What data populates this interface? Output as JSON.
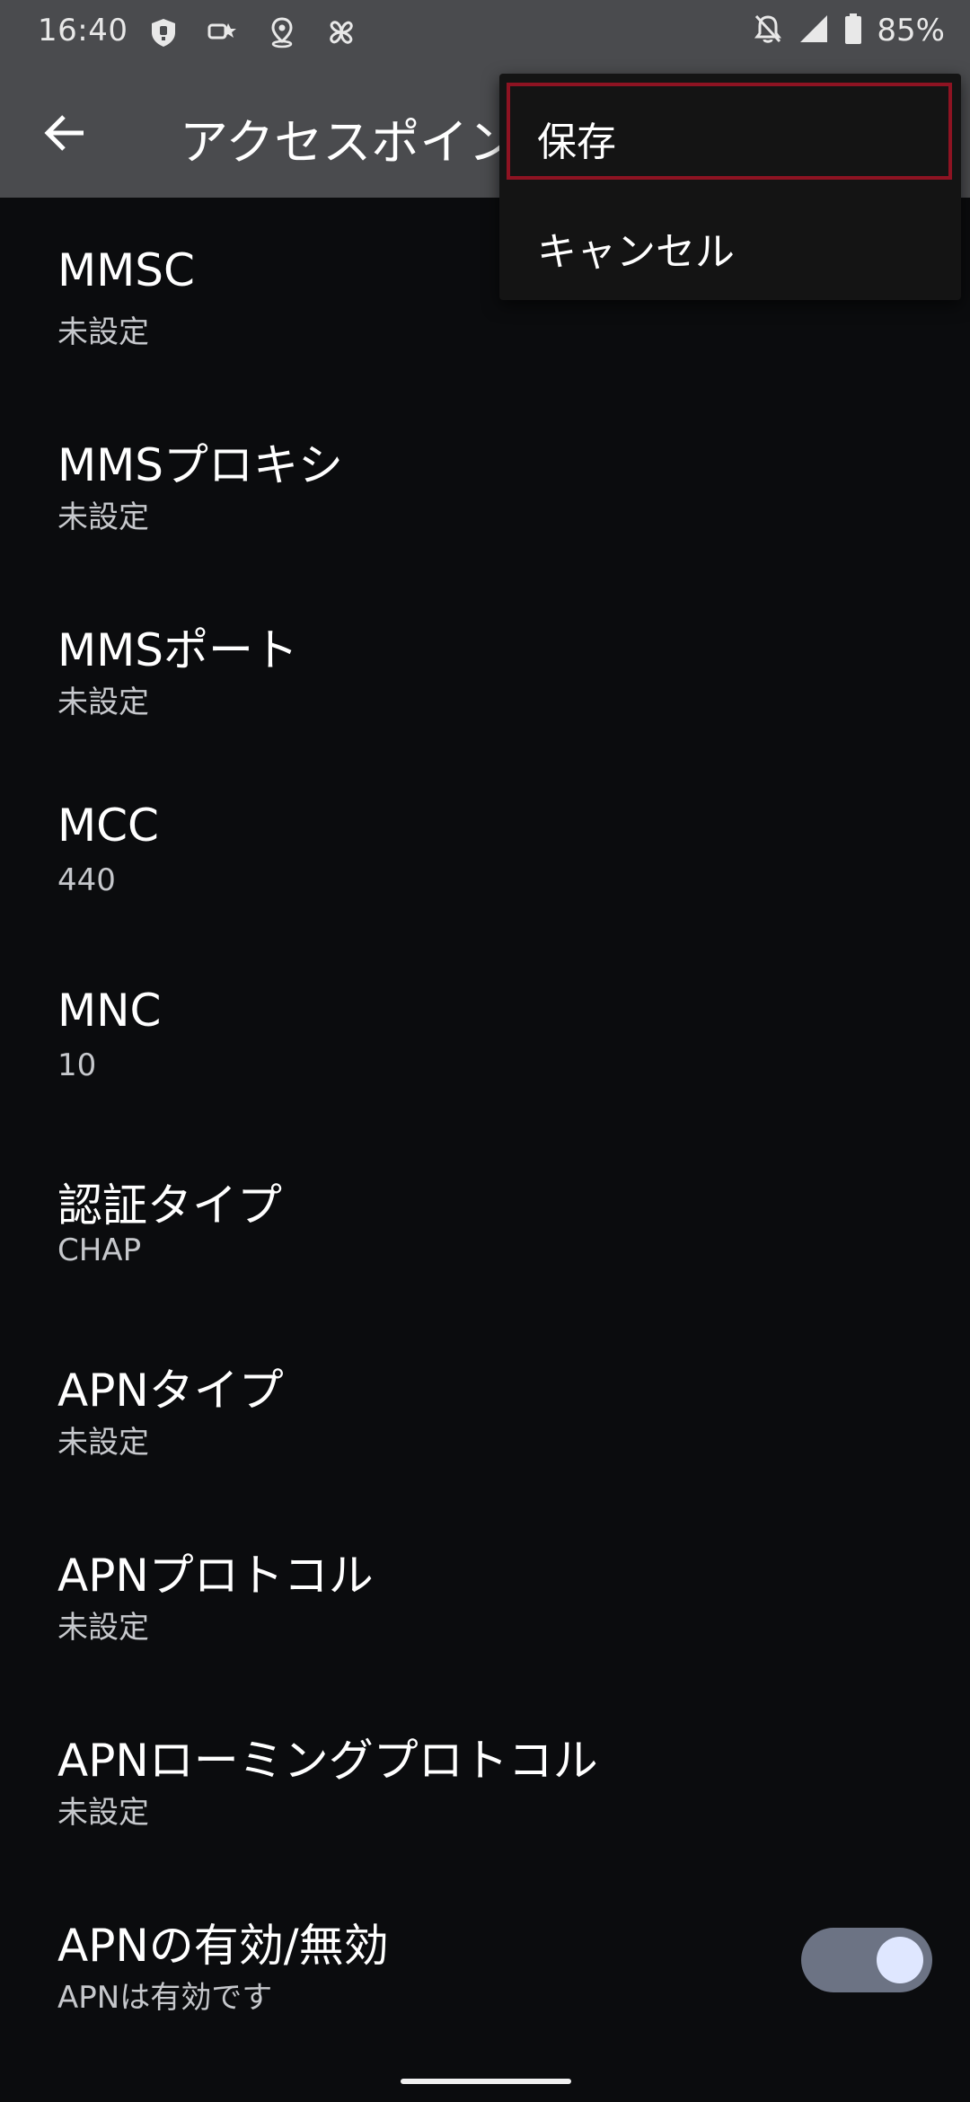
{
  "status_bar": {
    "time": "16:40",
    "battery_percent": "85%",
    "left_icons": [
      "shield-notification-icon",
      "weather-icon",
      "location-pin-icon",
      "pinwheel-icon"
    ],
    "right_icons": [
      "bell-off-icon",
      "signal-icon",
      "battery-icon"
    ]
  },
  "app_bar": {
    "title": "アクセスポイン"
  },
  "menu": {
    "items": [
      {
        "label": "保存"
      },
      {
        "label": "キャンセル"
      }
    ],
    "focus_color": "#8e1322"
  },
  "list": {
    "items": [
      {
        "title": "MMSC",
        "summary": "未設定"
      },
      {
        "title": "MMSプロキシ",
        "summary": "未設定"
      },
      {
        "title": "MMSポート",
        "summary": "未設定"
      },
      {
        "title": "MCC",
        "summary": "440"
      },
      {
        "title": "MNC",
        "summary": "10"
      },
      {
        "title": "認証タイプ",
        "summary": "CHAP"
      },
      {
        "title": "APNタイプ",
        "summary": "未設定"
      },
      {
        "title": "APNプロトコル",
        "summary": "未設定"
      },
      {
        "title": "APNローミングプロトコル",
        "summary": "未設定"
      },
      {
        "title": "APNの有効/無効",
        "summary": "APNは有効です",
        "toggle_on": true
      }
    ]
  },
  "colors": {
    "background": "#0b0c0e",
    "app_bar": "#4a4b4e",
    "toggle_track": "#6c7384",
    "toggle_thumb": "#dfe7ff"
  }
}
